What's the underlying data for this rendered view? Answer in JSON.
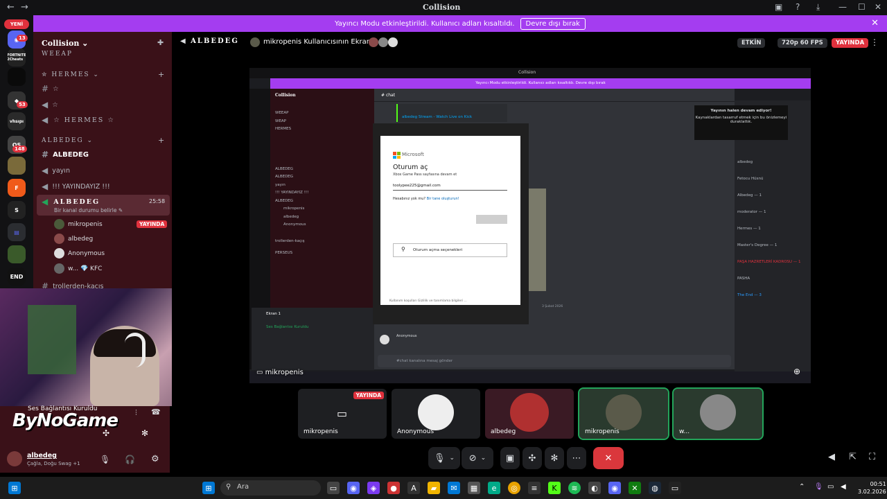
{
  "window": {
    "title": "Collision",
    "nav_back": "←",
    "nav_forward": "→"
  },
  "banner": {
    "text": "Yayıncı Modu etkinleştirildi. Kullanıcı adları kısaltıldı.",
    "button": "Devre dışı bırak",
    "color": "#a43df0"
  },
  "guilds": {
    "new_label": "YENİ",
    "badge_top": "13",
    "items": [
      "FORTNITE 2Cheats",
      "53",
      "vhsıpı",
      "148",
      "END"
    ]
  },
  "server": {
    "name": "Collision"
  },
  "channels": {
    "cat_weeap": "WEEAP",
    "cat_hermes": "HERMES",
    "hermes_items": [
      "☆",
      "☆",
      "☆ HERMES ☆"
    ],
    "cat_albedeg": "ALBEDEG",
    "albedeg_items": [
      "ALBEDEG",
      "yayın",
      "!!! YAYINDAYIZ !!!"
    ],
    "voice_channel": "ALBEDEG",
    "voice_time": "25:58",
    "voice_status": "Bir kanal durumu belirle",
    "voice_users": [
      {
        "name": "mikropenis",
        "live": "YAYINDA"
      },
      {
        "name": "albedeg"
      },
      {
        "name": "Anonymous"
      },
      {
        "name": "w... 💎 KFC"
      }
    ],
    "next_channel": "trollerden-kaçış"
  },
  "voice_panel": {
    "status": "Ses Bağlantısı Kuruldu",
    "watermark": "ByNoGame",
    "user": "albedeg",
    "user_sub": "Çağla, Doğu Swag +1"
  },
  "topbar": {
    "channel": "ALBEDEG",
    "screen_title": "mikropenis Kullanıcısının Ekranı",
    "active": "ETKİN",
    "quality": "720p 60 FPS",
    "live": "YAYINDA"
  },
  "stream": {
    "banner": "Yayıncı Modu etkinleştirildi. Kullanıcı adları kısaltıldı.   Devre dışı bırak",
    "chat_channel": "chat",
    "kick_title": "albedeg Stream - Watch Live on Kick",
    "tip_title": "Yayının halen devam ediyor!",
    "tip_body": "Kaynaklardan tasarruf etmek için bu önizlemeyi duraklattık.",
    "date_divider": "3 Şubat 2026",
    "chat_input": "#chat kanalına mesaj gönder",
    "sidebar_items": [
      "WEEAP",
      "WEAP",
      "HERMES",
      "ALBEDEG",
      "ALBEDEG",
      "yayın",
      "!!! YAYINDAYIZ !!!",
      "ALBEDEG",
      "mikropenis",
      "albedeg",
      "Anonymous",
      "trollerden-kaçış",
      "PERSEUS"
    ],
    "screen_label": "Ekran 1",
    "members": [
      "albedeg",
      "Fetocu Hüsnü",
      "Albedeg — 1",
      "moderator — 1",
      "Hermes — 1",
      "Master's Degree — 1",
      "PAŞA HAZRETLERİ KADROSU — 1",
      "PASHA",
      "The End — 3"
    ]
  },
  "ms_dialog": {
    "brand": "Microsoft",
    "title": "Oturum aç",
    "subtitle": "Xbox Game Pass sayfasına devam et",
    "email": "toolypee225@gmail.com",
    "no_account": "Hesabınız yok mu?",
    "create": "Bir tane oluşturun!",
    "options": "Oturum açma seçenekleri",
    "footer": "Kullanım koşulları    Gizlilik ve tanımlama bilgileri    ..."
  },
  "stream_caption": "mikropenis",
  "tiles": [
    {
      "name": "mikropenis",
      "live": "YAYINDA"
    },
    {
      "name": "Anonymous"
    },
    {
      "name": "albedeg"
    },
    {
      "name": "mikropenis"
    },
    {
      "name": "w..."
    }
  ],
  "taskbar": {
    "search": "Ara",
    "time": "00:51",
    "date": "3.02.2026"
  }
}
